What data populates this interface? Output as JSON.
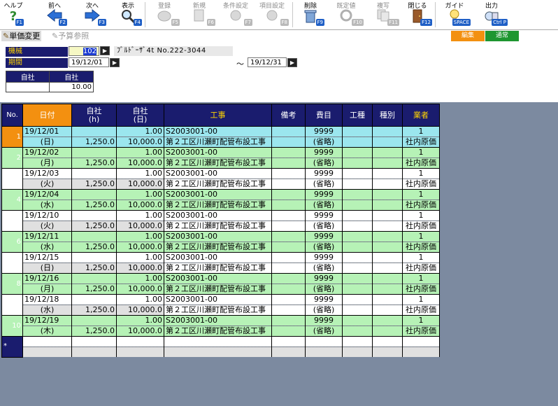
{
  "toolbar": {
    "items": [
      {
        "label": "ヘルプ",
        "fkey": "F1",
        "icon": "help-icon",
        "enabled": true
      },
      {
        "label": "前へ",
        "fkey": "F2",
        "icon": "arrow-left-icon",
        "enabled": true
      },
      {
        "label": "次へ",
        "fkey": "F3",
        "icon": "arrow-right-icon",
        "enabled": true
      },
      {
        "label": "表示",
        "fkey": "F4",
        "icon": "search-icon",
        "enabled": true
      },
      {
        "label": "登録",
        "fkey": "F5",
        "icon": "register-icon",
        "enabled": false
      },
      {
        "label": "新規",
        "fkey": "F6",
        "icon": "new-document-icon",
        "enabled": false
      },
      {
        "label": "条件設定",
        "fkey": "F7",
        "icon": "condition-settings-icon",
        "enabled": false
      },
      {
        "label": "項目設定",
        "fkey": "F8",
        "icon": "item-settings-icon",
        "enabled": false
      },
      {
        "label": "削除",
        "fkey": "F9",
        "icon": "trash-icon",
        "enabled": true
      },
      {
        "label": "既定値",
        "fkey": "F10",
        "icon": "default-value-icon",
        "enabled": false
      },
      {
        "label": "複写",
        "fkey": "F11",
        "icon": "copy-icon",
        "enabled": false
      },
      {
        "label": "閉じる",
        "fkey": "F12",
        "icon": "close-door-icon",
        "enabled": true
      },
      {
        "label": "ガイド",
        "fkey": "SPACE",
        "icon": "lightbulb-icon",
        "enabled": true
      },
      {
        "label": "出力",
        "fkey": "Ctrl P",
        "icon": "output-icon",
        "enabled": true
      }
    ]
  },
  "tabs": [
    {
      "label": "単価変更",
      "active": true,
      "icon": "unit-price-icon"
    },
    {
      "label": "予算参照",
      "active": false,
      "icon": "budget-icon"
    }
  ],
  "modes": {
    "edit": "編集",
    "normal": "通常",
    "edit_color": "#f39010",
    "normal_color": "#1e9630"
  },
  "form": {
    "machine_label": "機械",
    "machine_code": "102",
    "machine_name": "ﾌﾞﾙﾄﾞｰｻﾞ4t  No.222-3044",
    "period_label": "期間",
    "period_from": "19/12/01",
    "period_tilde": "～",
    "period_to": "19/12/31"
  },
  "summary": {
    "headers": [
      "自社",
      "自社"
    ],
    "value": "10.00"
  },
  "grid": {
    "headers": {
      "no": "No.",
      "date": "日付",
      "own_h": "自社",
      "own_h_unit": "(h)",
      "own_d": "自社",
      "own_d_unit": "(日)",
      "work": "工事",
      "remarks": "備考",
      "expense": "費目",
      "work_type": "工種",
      "kind": "種別",
      "vendor": "業者"
    },
    "rows": [
      {
        "no": "1",
        "date": "19/12/01",
        "dow": "(日)",
        "hours": "1,250.0",
        "days": "1.00",
        "amount": "10,000.0",
        "code": "S2003001-00",
        "name": "第２工区川瀬町配管布設工事",
        "exp_code": "9999",
        "exp_name": "(省略)",
        "vendor_code": "1",
        "vendor_name": "社内原価"
      },
      {
        "no": "2",
        "date": "19/12/02",
        "dow": "(月)",
        "hours": "1,250.0",
        "days": "1.00",
        "amount": "10,000.0",
        "code": "S2003001-00",
        "name": "第２工区川瀬町配管布設工事",
        "exp_code": "9999",
        "exp_name": "(省略)",
        "vendor_code": "1",
        "vendor_name": "社内原価"
      },
      {
        "no": "3",
        "date": "19/12/03",
        "dow": "(火)",
        "hours": "1,250.0",
        "days": "1.00",
        "amount": "10,000.0",
        "code": "S2003001-00",
        "name": "第２工区川瀬町配管布設工事",
        "exp_code": "9999",
        "exp_name": "(省略)",
        "vendor_code": "1",
        "vendor_name": "社内原価"
      },
      {
        "no": "4",
        "date": "19/12/04",
        "dow": "(水)",
        "hours": "1,250.0",
        "days": "1.00",
        "amount": "10,000.0",
        "code": "S2003001-00",
        "name": "第２工区川瀬町配管布設工事",
        "exp_code": "9999",
        "exp_name": "(省略)",
        "vendor_code": "1",
        "vendor_name": "社内原価"
      },
      {
        "no": "5",
        "date": "19/12/10",
        "dow": "(火)",
        "hours": "1,250.0",
        "days": "1.00",
        "amount": "10,000.0",
        "code": "S2003001-00",
        "name": "第２工区川瀬町配管布設工事",
        "exp_code": "9999",
        "exp_name": "(省略)",
        "vendor_code": "1",
        "vendor_name": "社内原価"
      },
      {
        "no": "6",
        "date": "19/12/11",
        "dow": "(水)",
        "hours": "1,250.0",
        "days": "1.00",
        "amount": "10,000.0",
        "code": "S2003001-00",
        "name": "第２工区川瀬町配管布設工事",
        "exp_code": "9999",
        "exp_name": "(省略)",
        "vendor_code": "1",
        "vendor_name": "社内原価"
      },
      {
        "no": "7",
        "date": "19/12/15",
        "dow": "(日)",
        "hours": "1,250.0",
        "days": "1.00",
        "amount": "10,000.0",
        "code": "S2003001-00",
        "name": "第２工区川瀬町配管布設工事",
        "exp_code": "9999",
        "exp_name": "(省略)",
        "vendor_code": "1",
        "vendor_name": "社内原価"
      },
      {
        "no": "8",
        "date": "19/12/16",
        "dow": "(月)",
        "hours": "1,250.0",
        "days": "1.00",
        "amount": "10,000.0",
        "code": "S2003001-00",
        "name": "第２工区川瀬町配管布設工事",
        "exp_code": "9999",
        "exp_name": "(省略)",
        "vendor_code": "1",
        "vendor_name": "社内原価"
      },
      {
        "no": "9",
        "date": "19/12/18",
        "dow": "(水)",
        "hours": "1,250.0",
        "days": "1.00",
        "amount": "10,000.0",
        "code": "S2003001-00",
        "name": "第２工区川瀬町配管布設工事",
        "exp_code": "9999",
        "exp_name": "(省略)",
        "vendor_code": "1",
        "vendor_name": "社内原価"
      },
      {
        "no": "10",
        "date": "19/12/19",
        "dow": "(木)",
        "hours": "1,250.0",
        "days": "1.00",
        "amount": "10,000.0",
        "code": "S2003001-00",
        "name": "第２工区川瀬町配管布設工事",
        "exp_code": "9999",
        "exp_name": "(省略)",
        "vendor_code": "1",
        "vendor_name": "社内原価"
      }
    ],
    "new_row_marker": "*"
  },
  "colors": {
    "header_navy": "#1a1c6e",
    "highlight_orange": "#f39010",
    "row_green": "#b6f2b6",
    "row_cyan": "#9be6ee",
    "background_slate": "#7c8aa0"
  }
}
